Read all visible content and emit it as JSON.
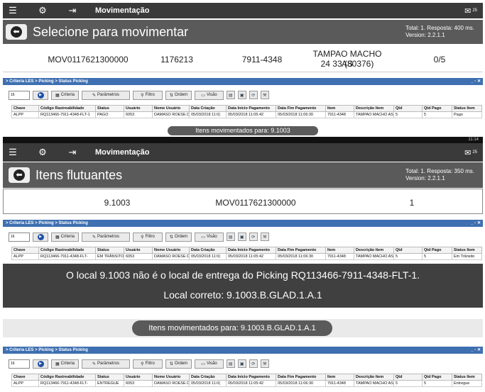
{
  "screen1": {
    "appbar_title": "Movimentação",
    "appbar_badge": "25",
    "heading": "Selecione para movimentar",
    "meta_line1": "Total: 1. Resposta: 400 ms.",
    "meta_line2": "Version: 2.2.1.1",
    "row": {
      "col1": "MOV0117621300000",
      "col2": "1176213",
      "col3": "7911-4348",
      "col4_line1": "TAMPAO MACHO AS",
      "col4_line2": "24 33 (80376)",
      "col5": "0/5"
    }
  },
  "criteria": {
    "title": "> Criteria LES > Picking > Status Picking",
    "window_controls": "_ ▫ ✕",
    "spinner_value": "16",
    "buttons": {
      "criteria": "Criteria",
      "parametros": "Parâmetros",
      "filtro": "Filtro",
      "ordem": "Ordem",
      "visao": "Visão"
    },
    "headers": [
      "Chave",
      "Código Rastreabilidade",
      "Status",
      "Usuário",
      "Nome Usuário",
      "Data Criação",
      "Data Início Pagamento",
      "Data Fim Pagamento",
      "Item",
      "Descrição Item",
      "Qtd",
      "Qtd Pago",
      "Status Item"
    ],
    "grid1_row": [
      "ALPP",
      "RQ113466-7911-4348-FLT-1",
      "PAGO",
      "6053",
      "DAMASO ROESE Di",
      "05/03/2018 11:0(",
      "05/03/2018 11:05:42",
      "05/03/2018 11:06:30",
      "7911-4348",
      "TAMPAO MACHO AS",
      "5",
      "5",
      "Pago"
    ],
    "grid2_row": [
      "ALPP",
      "RQ113466-7911-4348-FLT-",
      "EM TRÂNSITO",
      "6053",
      "DAMASO ROESE Di",
      "05/03/2018 11:0(",
      "05/03/2018 11:05:42",
      "05/03/2018 11:06:30",
      "7911-4348",
      "TAMPAO MACHO AS",
      "5",
      "5",
      "Em Trânsito"
    ],
    "grid3_row": [
      "ALPP",
      "RQ113466-7911-4348-FLT-",
      "ENTREGUE",
      "6053",
      "DAMASO ROESE Di",
      "05/03/2018 11:0(",
      "05/03/2018 11:05:42",
      "05/03/2018 11:06:30",
      "7911-4348",
      "TAMPAO MACHO AS",
      "5",
      "5",
      "Entregue"
    ]
  },
  "toast1": "Itens movimentados para: 9.1003",
  "screen2": {
    "status_time": "11:14",
    "appbar_title": "Movimentação",
    "appbar_badge": "25",
    "heading": "Itens flutuantes",
    "meta_line1": "Total: 1. Resposta: 350 ms.",
    "meta_line2": "Version: 2.2.1.1",
    "row": {
      "col1": "9.1003",
      "col2": "MOV0117621300000",
      "col3": "1"
    }
  },
  "error": {
    "line1": "O local 9.1003 não é o local de entrega do Picking RQ113466-7911-4348-FLT-1.",
    "line2": "Local correto: 9.1003.B.GLAD.1.A.1"
  },
  "toast2": "Itens movimentados para: 9.1003.B.GLAD.1.A.1",
  "colors": {
    "appbar": "#3a3a3a",
    "subbar": "#5a5a5a",
    "criteria_title": "#3e6fb0"
  },
  "icons": [
    "menu-icon",
    "gear-icon",
    "exit-icon",
    "envelope-icon",
    "back-arrow-icon",
    "play-icon"
  ]
}
